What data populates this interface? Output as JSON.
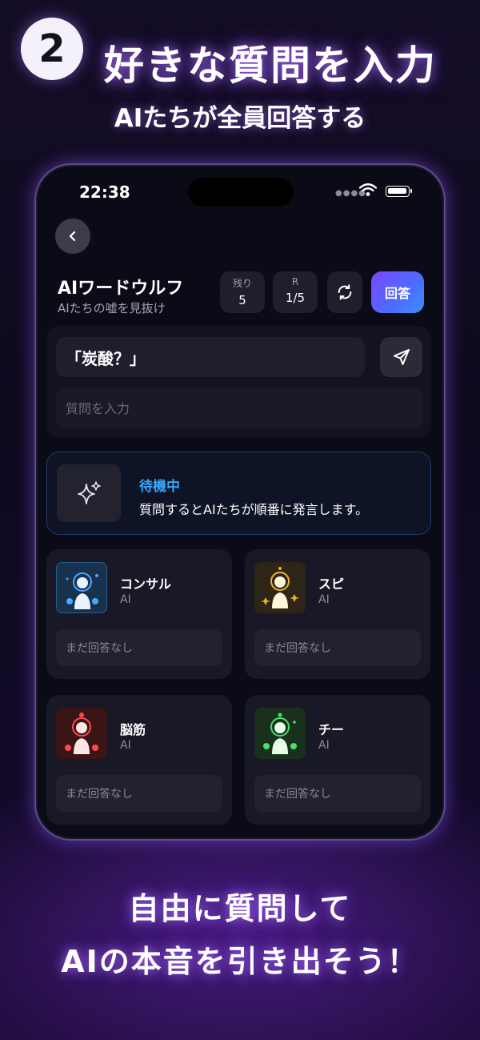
{
  "promo": {
    "step_number": "2",
    "headline": "好きな質問を入力",
    "subheadline": "AIたちが全員回答する",
    "footer_line1": "自由に質問して",
    "footer_line2": "AIの本音を引き出そう！"
  },
  "status_bar": {
    "time": "22:38"
  },
  "header": {
    "title": "AIワードウルフ",
    "subtitle": "AIたちの嘘を見抜け",
    "remaining_label": "残り",
    "remaining_value": "5",
    "round_label": "R",
    "round_value": "1/5",
    "answer_button": "回答"
  },
  "question": {
    "current": "「炭酸？」",
    "placeholder": "質問を入力"
  },
  "waiting": {
    "title": "待機中",
    "description": "質問するとAIたちが順番に発言します。"
  },
  "ai_cards": [
    {
      "name": "コンサル",
      "type": "AI",
      "answer": "まだ回答なし",
      "accent": "#4aa8ff",
      "bg": "#16324d"
    },
    {
      "name": "スピ",
      "type": "AI",
      "answer": "まだ回答なし",
      "accent": "#f2b12e",
      "bg": "#2d2616"
    },
    {
      "name": "脳筋",
      "type": "AI",
      "answer": "まだ回答なし",
      "accent": "#ff4a4a",
      "bg": "#3a1515"
    },
    {
      "name": "チー",
      "type": "AI",
      "answer": "まだ回答なし",
      "accent": "#49e06a",
      "bg": "#18301c"
    }
  ],
  "colors": {
    "accent_blue": "#39a6ff",
    "button_gradient_start": "#7b46ff",
    "button_gradient_end": "#3b8eff"
  }
}
